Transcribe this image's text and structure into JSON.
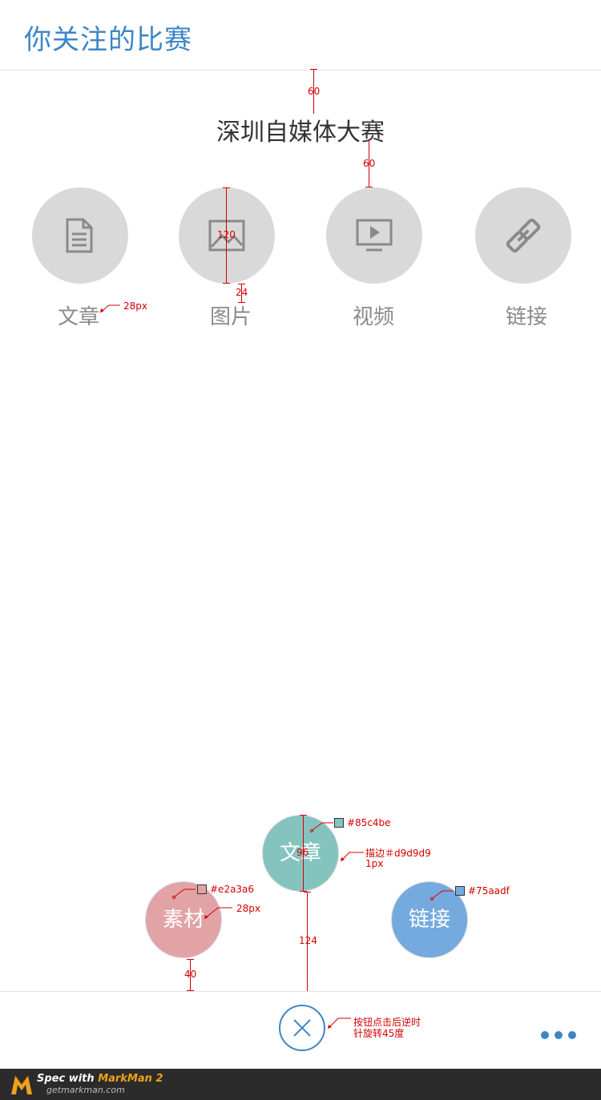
{
  "header": {
    "title": "你关注的比赛"
  },
  "contest": {
    "title": "深圳自媒体大赛"
  },
  "categories": [
    {
      "label": "文章",
      "icon": "document-icon"
    },
    {
      "label": "图片",
      "icon": "image-icon"
    },
    {
      "label": "视频",
      "icon": "video-icon"
    },
    {
      "label": "链接",
      "icon": "link-icon"
    }
  ],
  "fab_menu": {
    "items": [
      {
        "label": "文章",
        "color": "#85c4be"
      },
      {
        "label": "素材",
        "color": "#e2a3a6"
      },
      {
        "label": "链接",
        "color": "#75aadf"
      }
    ]
  },
  "annotations": {
    "top_gap": "60",
    "title_gap": "60",
    "icon_size": "120",
    "label_gap": "24",
    "label_font": "28px",
    "fab_size": "96",
    "fab_green": "#85c4be",
    "stroke_note_1": "描边＃d9d9d9",
    "stroke_note_2": "1px",
    "fab_pink": "#e2a3a6",
    "fab_font": "28px",
    "fab_blue": "#75aadf",
    "fab_gap": "124",
    "bottom_gap": "40",
    "close_note_1": "按钮点击后逆时",
    "close_note_2": "针旋转45度"
  },
  "footer": {
    "close_icon": "close-icon",
    "more_icon": "more-icon"
  },
  "markman": {
    "spec": "Spec with",
    "brand": "MarkMan 2",
    "site": "getmarkman.com"
  }
}
